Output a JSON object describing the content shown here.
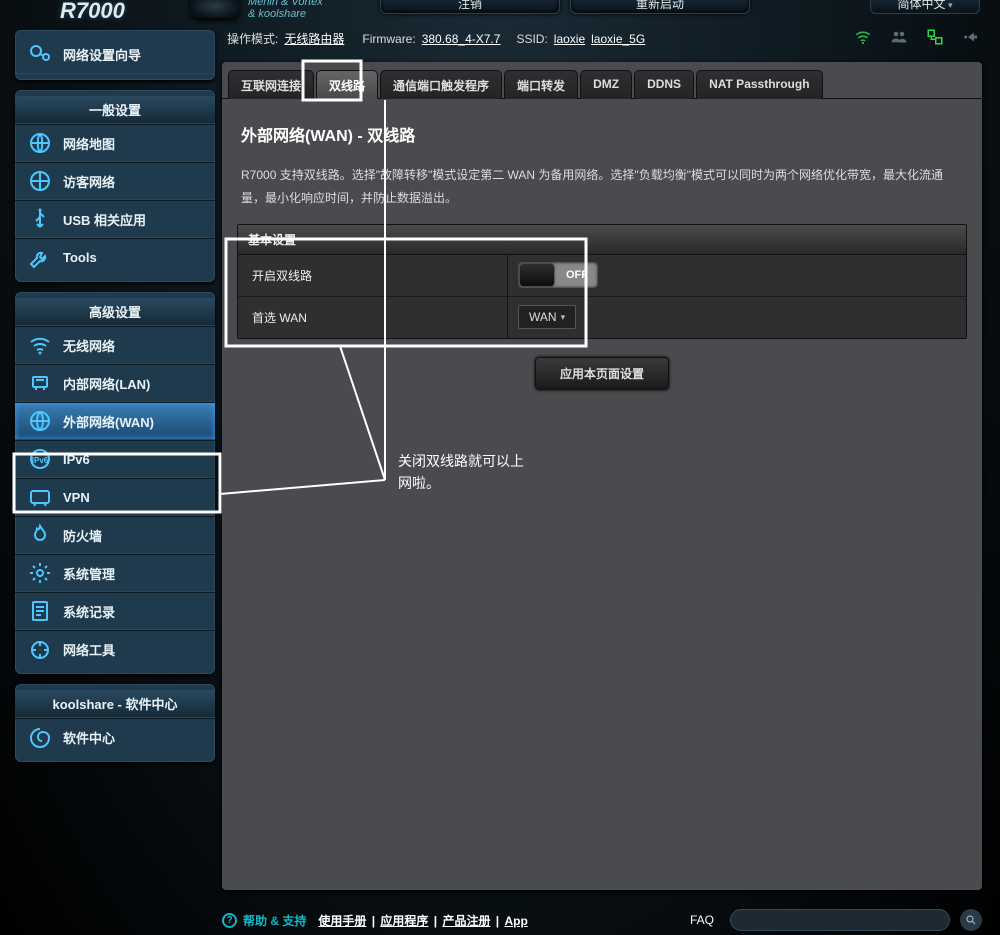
{
  "header": {
    "model": "R7000",
    "sub1": "Merlin & Vortex",
    "sub2": "& koolshare",
    "btn_logout": "注销",
    "btn_reboot": "重新启动",
    "language": "简体中文"
  },
  "status": {
    "mode_label": "操作模式:",
    "mode_value": "无线路由器",
    "fw_label": "Firmware:",
    "fw_value": "380.68_4-X7.7",
    "ssid_label": "SSID:",
    "ssid1": "laoxie",
    "ssid2": "laoxie_5G"
  },
  "sidebar": {
    "wizard": "网络设置向导",
    "general_title": "一般设置",
    "general": [
      {
        "label": "网络地图",
        "icon": "globe"
      },
      {
        "label": "访客网络",
        "icon": "globe-g"
      },
      {
        "label": "USB 相关应用",
        "icon": "usb"
      },
      {
        "label": "Tools",
        "icon": "wrench"
      }
    ],
    "advanced_title": "高级设置",
    "advanced": [
      {
        "label": "无线网络",
        "icon": "wifi"
      },
      {
        "label": "内部网络(LAN)",
        "icon": "lan"
      },
      {
        "label": "外部网络(WAN)",
        "icon": "wan",
        "active": true
      },
      {
        "label": "IPv6",
        "icon": "ipv6"
      },
      {
        "label": "VPN",
        "icon": "vpn"
      },
      {
        "label": "防火墙",
        "icon": "firewall"
      },
      {
        "label": "系统管理",
        "icon": "gear"
      },
      {
        "label": "系统记录",
        "icon": "log"
      },
      {
        "label": "网络工具",
        "icon": "tools"
      }
    ],
    "koolshare_title": "koolshare - 软件中心",
    "koolshare": [
      {
        "label": "软件中心",
        "icon": "swirl"
      }
    ]
  },
  "tabs": [
    "互联网连接",
    "双线路",
    "通信端口触发程序",
    "端口转发",
    "DMZ",
    "DDNS",
    "NAT Passthrough"
  ],
  "active_tab_index": 1,
  "page": {
    "title": "外部网络(WAN) - 双线路",
    "desc": "R7000 支持双线路。选择\"故障转移\"模式设定第二 WAN 为备用网络。选择\"负载均衡\"模式可以同时为两个网络优化带宽，最大化流通量，最小化响应时间，并防止数据溢出。",
    "section_title": "基本设置",
    "rows": {
      "enable_label": "开启双线路",
      "toggle_state": "OFF",
      "primary_label": "首选 WAN",
      "primary_value": "WAN"
    },
    "apply": "应用本页面设置"
  },
  "annotations": {
    "tip_label_1": "关闭双线路就可以上",
    "tip_label_2": "网啦。"
  },
  "footer": {
    "help": "帮助 & 支持",
    "links": [
      "使用手册",
      "应用程序",
      "产品注册",
      "App"
    ],
    "faq": "FAQ"
  }
}
